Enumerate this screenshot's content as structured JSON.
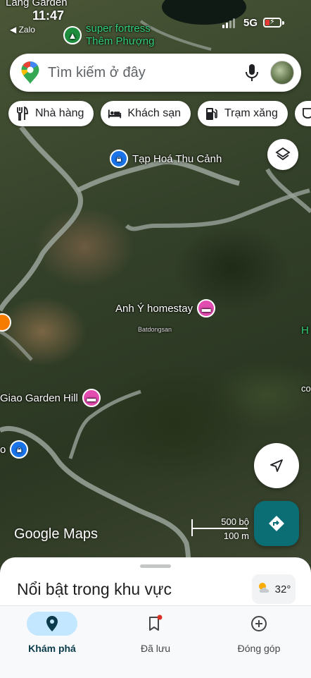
{
  "status_bar": {
    "time": "11:47",
    "back_app": "◀ Zalo",
    "network": "5G",
    "battery_level": 0.3
  },
  "search": {
    "placeholder": "Tìm kiếm ở đây"
  },
  "chips": [
    {
      "label": "Nhà hàng",
      "icon": "restaurant-icon"
    },
    {
      "label": "Khách sạn",
      "icon": "hotel-icon"
    },
    {
      "label": "Trạm xăng",
      "icon": "gas-station-icon"
    },
    {
      "label": "",
      "icon": "cafe-icon"
    }
  ],
  "map": {
    "top_places": [
      "Lang Garden",
      "super fortress",
      "Thêm Phượng"
    ],
    "places": [
      {
        "label": "Tạp Hoá Thu Cảnh",
        "type": "shop"
      },
      {
        "label": "Anh Ý homestay",
        "type": "hotel"
      },
      {
        "label": "Giao Garden Hill",
        "type": "hotel"
      },
      {
        "label": "o",
        "type": "shop"
      },
      {
        "label": "H",
        "type": "edge"
      },
      {
        "label": "co",
        "type": "edge"
      }
    ],
    "watermark": "Batdongsan",
    "brand": "Google Maps",
    "scale_top": "500 bộ",
    "scale_bottom": "100 m"
  },
  "sheet": {
    "title": "Nổi bật trong khu vực",
    "temperature": "32°"
  },
  "nav": {
    "items": [
      {
        "label": "Khám phá",
        "icon": "explore-pin-icon",
        "active": true
      },
      {
        "label": "Đã lưu",
        "icon": "bookmark-icon",
        "active": false
      },
      {
        "label": "Đóng góp",
        "icon": "add-circle-icon",
        "active": false
      }
    ]
  },
  "colors": {
    "accent": "#1a73e8",
    "hotel_pin": "#e24bb0",
    "directions_button": "#0b6e75",
    "nav_active": "#c2e7ff"
  }
}
